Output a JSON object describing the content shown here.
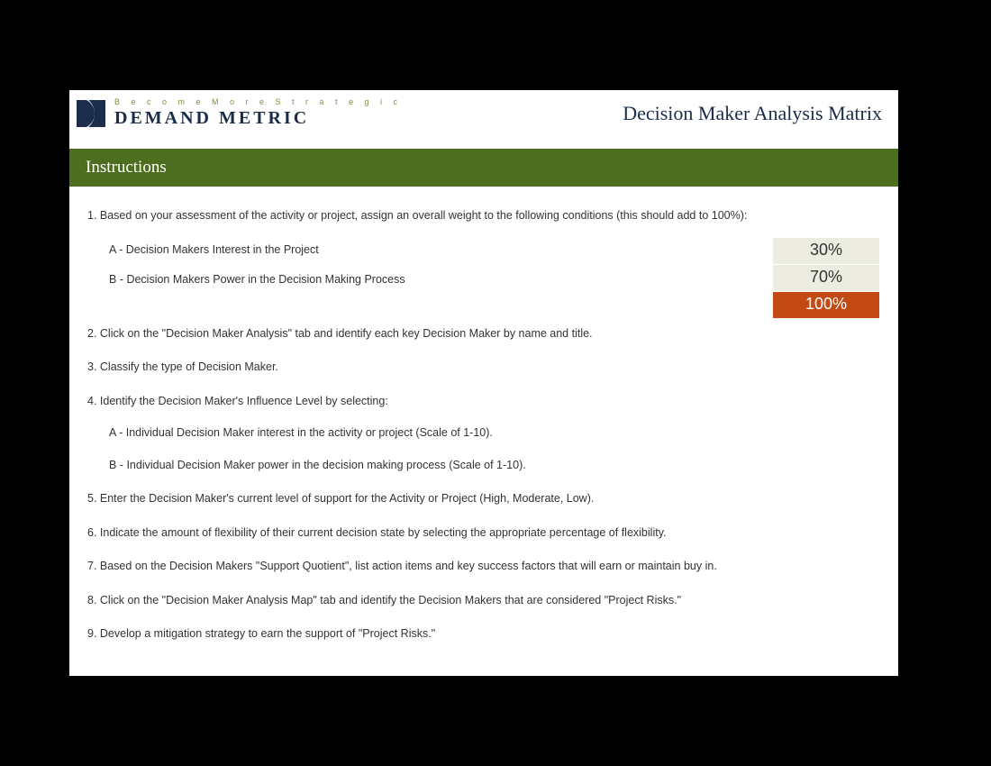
{
  "logo": {
    "tagline": "B e c o m e   M o r e   S t r a t e g i c",
    "brand": "DEMAND METRIC"
  },
  "doc_title": "Decision Maker Analysis Matrix",
  "section_title": "Instructions",
  "step1": "1. Based on your assessment of the activity or project, assign an overall weight to the following conditions (this should add to 100%):",
  "conditions": {
    "a_label": "A - Decision Makers Interest in the Project",
    "b_label": "B - Decision Makers Power in the Decision Making Process",
    "a_value": "30%",
    "b_value": "70%",
    "total": "100%"
  },
  "step2": "2. Click on the \"Decision Maker Analysis\" tab and identify each key Decision Maker by name and title.",
  "step3": "3. Classify the type of Decision Maker.",
  "step4": "4. Identify the Decision Maker's Influence Level by selecting:",
  "step4a": "A - Individual Decision Maker interest in the activity or project (Scale of 1-10).",
  "step4b": "B - Individual Decision Maker power in the decision making process (Scale of 1-10).",
  "step5": "5. Enter the Decision Maker's current level of support for the Activity or Project (High, Moderate, Low).",
  "step6": "6. Indicate the amount of flexibility of their current decision state by selecting the appropriate percentage of flexibility.",
  "step7": "7. Based on the Decision Makers \"Support Quotient\", list action items and key success factors that will earn or maintain buy in.",
  "step8": "8. Click on the \"Decision Maker Analysis Map\" tab and identify the Decision Makers that are considered \"Project Risks.\"",
  "step9": "9. Develop a mitigation strategy to earn the support of \"Project Risks.\""
}
